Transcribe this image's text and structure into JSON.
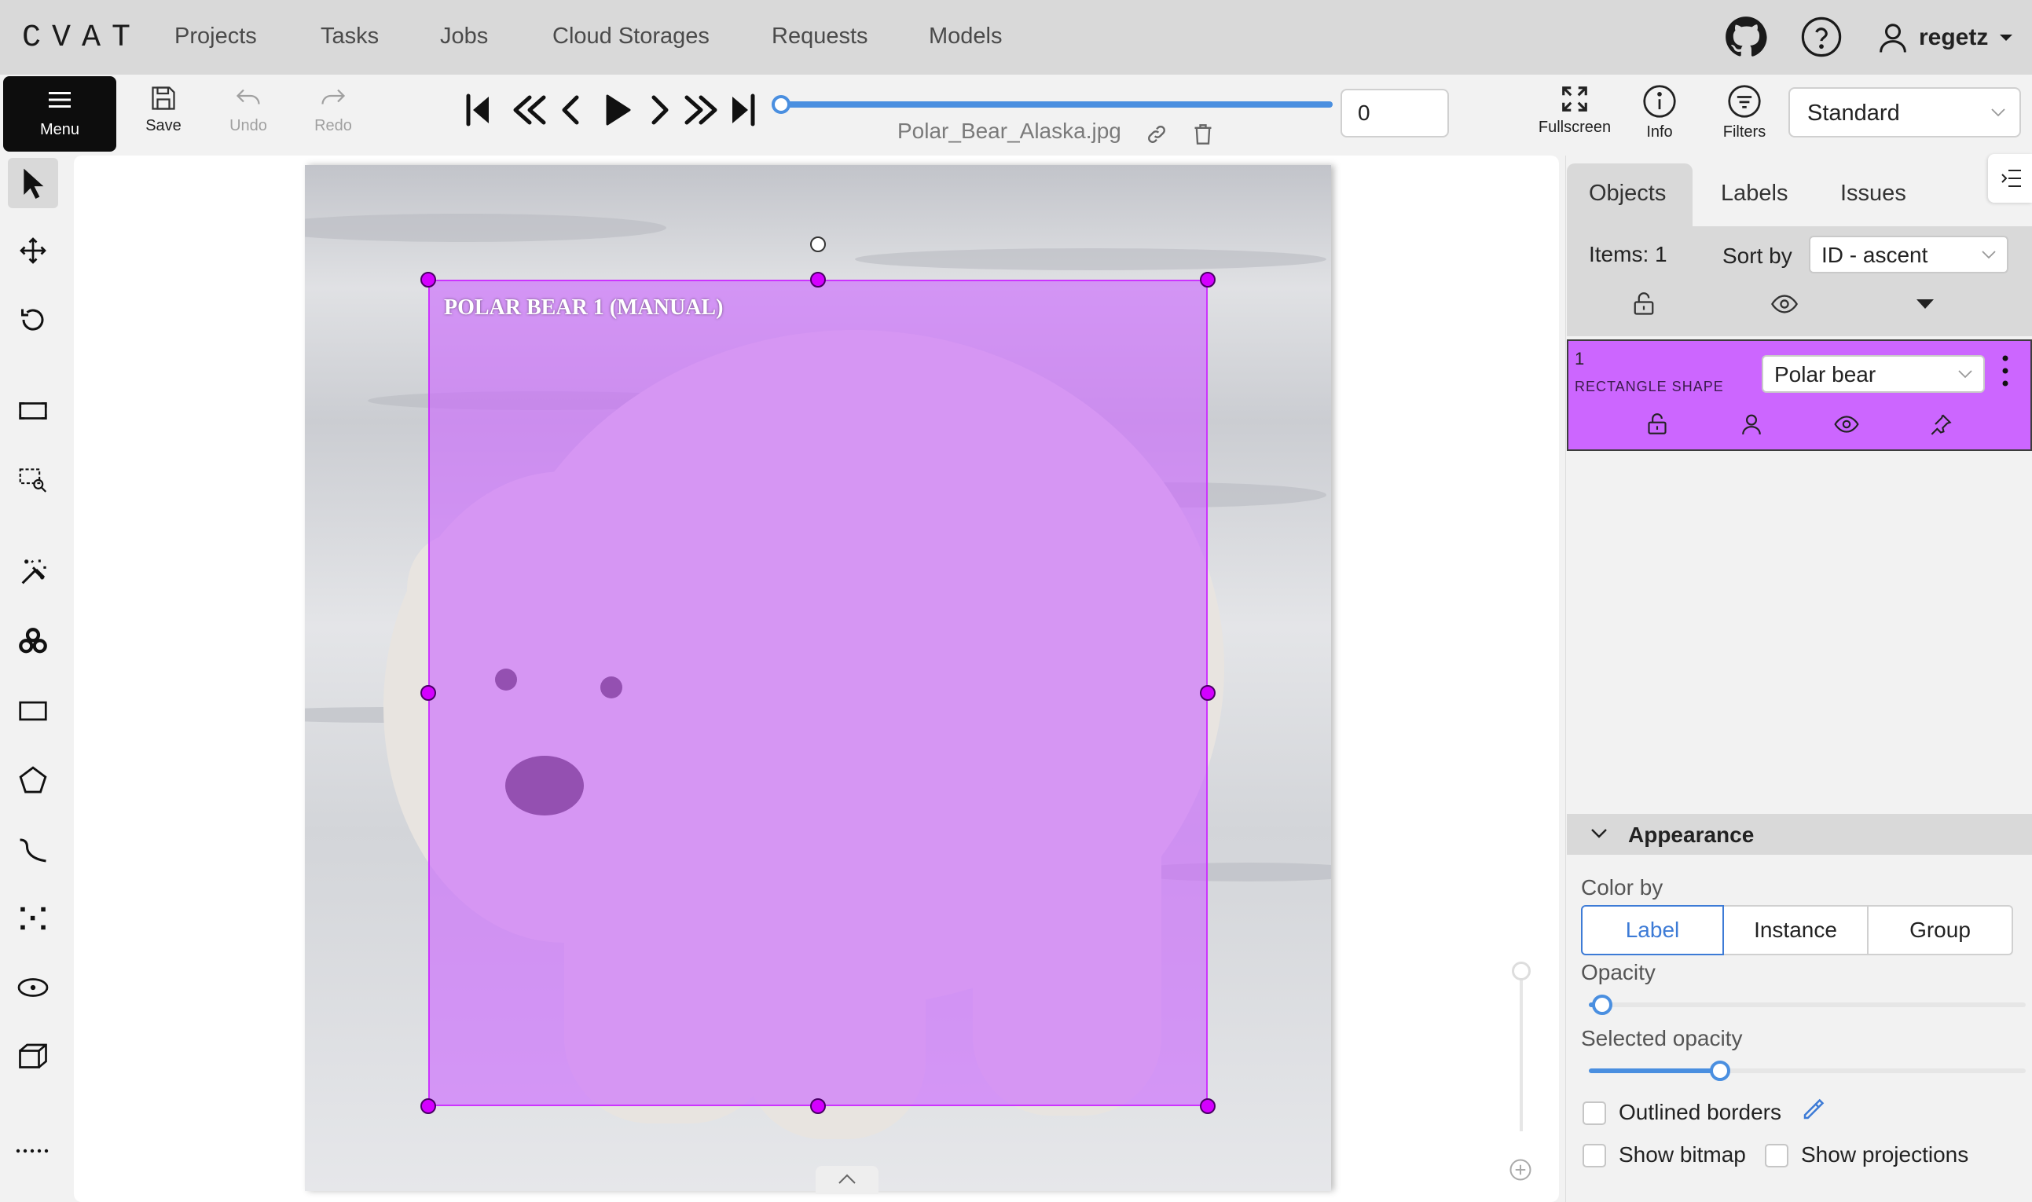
{
  "app": {
    "logo": "CVAT",
    "nav": [
      "Projects",
      "Tasks",
      "Jobs",
      "Cloud Storages",
      "Requests",
      "Models"
    ],
    "username": "regetz"
  },
  "toolbar": {
    "menu_label": "Menu",
    "save_label": "Save",
    "undo_label": "Undo",
    "redo_label": "Redo",
    "frame_number": "0",
    "filename": "Polar_Bear_Alaska.jpg",
    "fullscreen_label": "Fullscreen",
    "info_label": "Info",
    "filters_label": "Filters",
    "workspace": "Standard",
    "player_progress": 1.0
  },
  "left_tools": [
    "cursor",
    "move",
    "rotate",
    "fit",
    "zoom-region",
    "magic-wand",
    "openvino",
    "rectangle",
    "polygon",
    "polyline",
    "points",
    "ellipse",
    "cuboid",
    "more"
  ],
  "canvas": {
    "shape_label": "POLAR BEAR 1 (MANUAL)"
  },
  "objects_panel": {
    "tabs": [
      "Objects",
      "Labels",
      "Issues"
    ],
    "active_tab": "Objects",
    "items_count": "Items: 1",
    "sort_by_label": "Sort by",
    "sort_value": "ID - ascent",
    "objects": [
      {
        "id": "1",
        "type": "RECTANGLE SHAPE",
        "label": "Polar bear",
        "color": "#cc66ff"
      }
    ]
  },
  "appearance": {
    "title": "Appearance",
    "color_by_label": "Color by",
    "color_by_options": [
      "Label",
      "Instance",
      "Group"
    ],
    "color_by_selected": "Label",
    "opacity_label": "Opacity",
    "opacity_value": 0.03,
    "selected_opacity_label": "Selected opacity",
    "selected_opacity_value": 0.3,
    "outlined_borders_label": "Outlined borders",
    "show_bitmap_label": "Show bitmap",
    "show_projections_label": "Show projections"
  }
}
